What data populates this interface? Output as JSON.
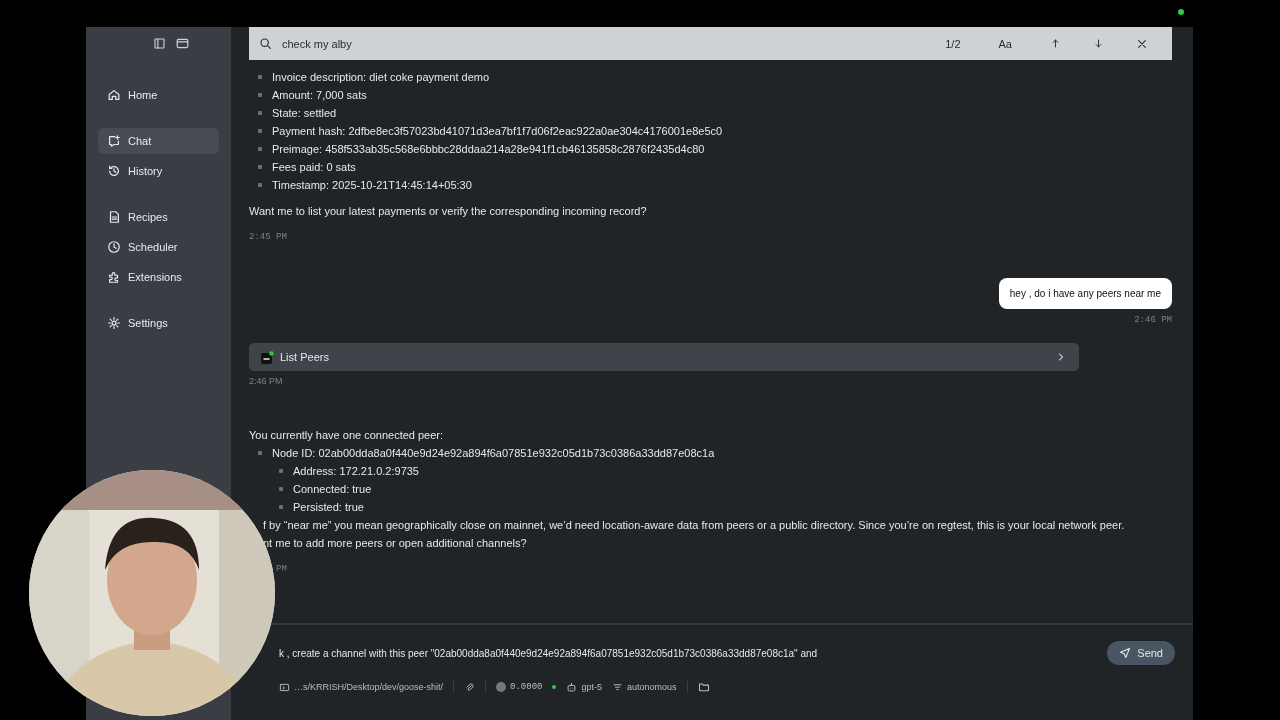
{
  "sidebar": {
    "groups": [
      {
        "items": [
          {
            "label": "Home",
            "selected": false
          }
        ]
      },
      {
        "items": [
          {
            "label": "Chat",
            "selected": true
          },
          {
            "label": "History",
            "selected": false
          }
        ]
      },
      {
        "items": [
          {
            "label": "Recipes",
            "selected": false
          },
          {
            "label": "Scheduler",
            "selected": false
          },
          {
            "label": "Extensions",
            "selected": false
          }
        ]
      },
      {
        "items": [
          {
            "label": "Settings",
            "selected": false
          }
        ]
      }
    ]
  },
  "find_bar": {
    "value": "check my alby",
    "count": "1/2",
    "case_label": "Aa"
  },
  "messages": [
    {
      "kind": "assistant",
      "blocks": [
        {
          "kind": "list",
          "items": [
            {
              "text": "Invoice description: diet coke payment demo"
            },
            {
              "text": "Amount: 7,000 sats"
            },
            {
              "text": "State: settled"
            },
            {
              "text": "Payment hash: 2dfbe8ec3f57023bd41071d3ea7bf1f7d06f2eac922a0ae304c4176001e8e5c0"
            },
            {
              "text": "Preimage: 458f533ab35c568e6bbbc28ddaa214a28e941f1cb46135858c2876f2435d4c80"
            },
            {
              "text": "Fees paid: 0 sats"
            },
            {
              "text": "Timestamp: 2025-10-21T14:45:14+05:30"
            }
          ]
        },
        {
          "kind": "paragraph",
          "text": "Want me to list your latest payments or verify the corresponding incoming record?"
        }
      ],
      "time": "2:45 PM"
    },
    {
      "kind": "user",
      "text": "hey , do i have any peers near me",
      "time": "2:46 PM"
    },
    {
      "kind": "tool",
      "label": "List Peers",
      "time": "2:46 PM"
    },
    {
      "kind": "assistant",
      "blocks": [
        {
          "kind": "paragraph",
          "text": "You currently have one connected peer:"
        },
        {
          "kind": "list",
          "items": [
            {
              "text": "Node ID: 02ab00dda8a0f440e9d24e92a894f6a07851e932c05d1b73c0386a33dd87e08c1a",
              "children": [
                {
                  "text": "Address: 172.21.0.2:9735"
                },
                {
                  "text": "Connected: true"
                },
                {
                  "text": "Persisted: true"
                }
              ]
            }
          ]
        },
        {
          "kind": "paragraph",
          "text": "f by “near me” you mean geographically close on mainnet, we’d need location-aware data from peers or a public directory. Since you’re on regtest, this is your local network peer.",
          "hidden_start": true
        },
        {
          "kind": "paragraph",
          "text": "nt me to add more peers or open additional channels?",
          "hidden_start": true
        }
      ],
      "time": "PM",
      "time_hidden_start": true
    }
  ],
  "composer": {
    "value": "k , create a channel with this peer \"02ab00dda8a0f440e9d24e92a894f6a07851e932c05d1b73c0386a33dd87e08c1a\" and",
    "send_label": "Send"
  },
  "footer": {
    "path": "…s/KRRISH/Desktop/dev/goose-shit/",
    "cost": "0.0000",
    "model": "gpt-5",
    "mode": "autonomous"
  }
}
